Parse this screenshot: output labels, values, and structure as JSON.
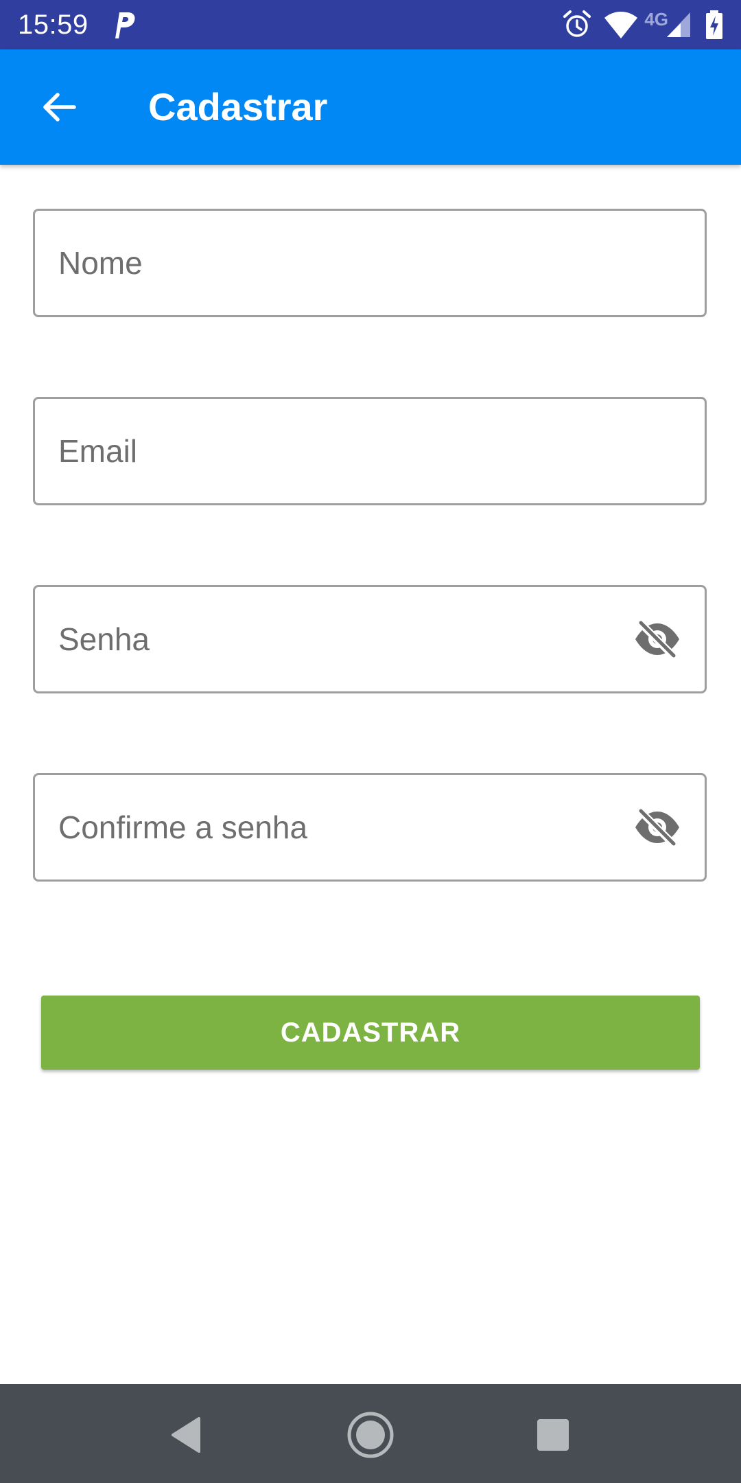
{
  "status_bar": {
    "time": "15:59",
    "network_label": "4G",
    "icons": [
      "parking-app-icon",
      "alarm-icon",
      "wifi-icon",
      "cell-signal-icon",
      "battery-charging-icon"
    ]
  },
  "app_bar": {
    "title": "Cadastrar",
    "back_icon": "arrow-back-icon"
  },
  "form": {
    "name": {
      "placeholder": "Nome",
      "value": ""
    },
    "email": {
      "placeholder": "Email",
      "value": ""
    },
    "password": {
      "placeholder": "Senha",
      "value": "",
      "toggle_icon": "visibility-off-icon"
    },
    "confirm_password": {
      "placeholder": "Confirme a senha",
      "value": "",
      "toggle_icon": "visibility-off-icon"
    },
    "submit_label": "CADASTRAR"
  },
  "nav_bar": {
    "icons": [
      "nav-back-icon",
      "nav-home-icon",
      "nav-recents-icon"
    ]
  },
  "colors": {
    "status_bar": "#303f9f",
    "app_bar": "#0288f5",
    "submit_button": "#7cb342",
    "field_border": "#9e9e9e",
    "nav_bar": "#474d52"
  }
}
